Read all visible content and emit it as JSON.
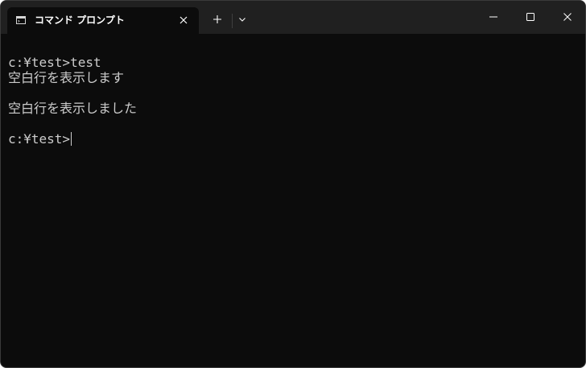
{
  "tab": {
    "title": "コマンド プロンプト",
    "icon": "command-prompt-icon"
  },
  "titlebar": {
    "new_tab_icon": "plus-icon",
    "dropdown_icon": "chevron-down-icon",
    "minimize_icon": "minimize-icon",
    "maximize_icon": "maximize-icon",
    "close_icon": "close-icon"
  },
  "terminal": {
    "lines": [
      "",
      "c:¥test>test",
      "空白行を表示します",
      "",
      "空白行を表示しました",
      "",
      "c:¥test>"
    ]
  },
  "colors": {
    "titlebar": "#202020",
    "terminal_background": "#0c0c0c",
    "text": "#cccccc"
  }
}
